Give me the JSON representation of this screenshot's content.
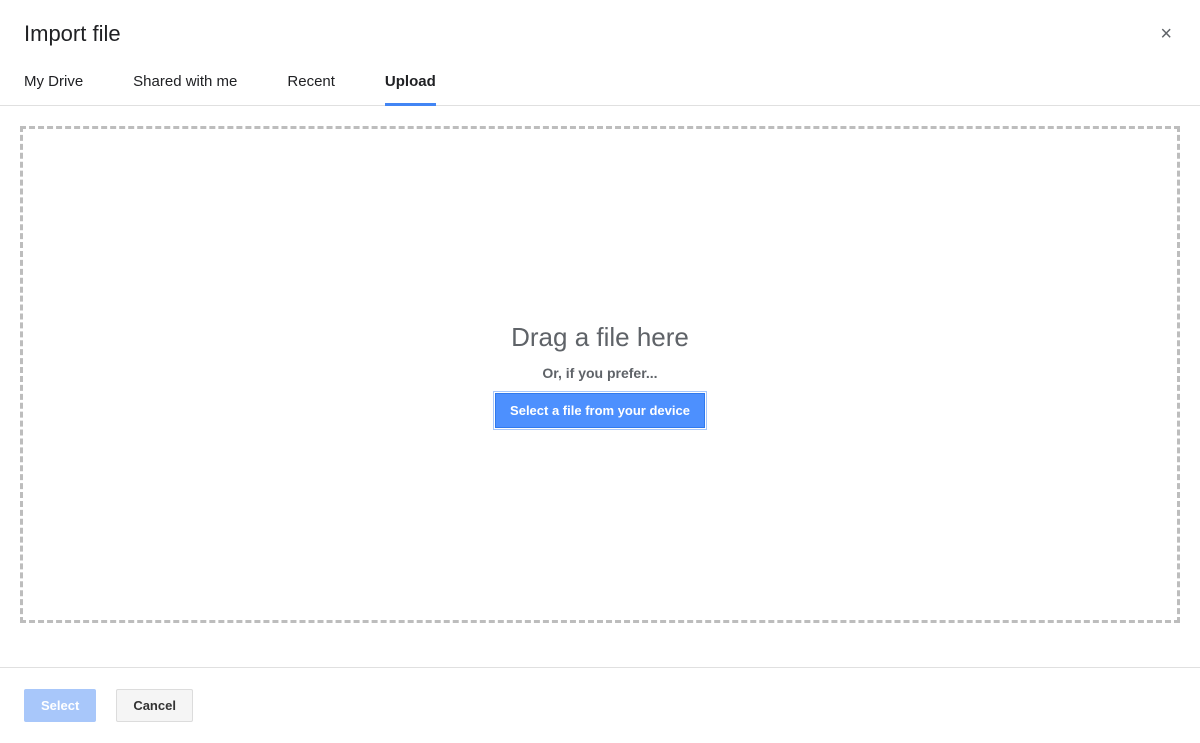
{
  "dialog": {
    "title": "Import file",
    "close_label": "×"
  },
  "tabs": {
    "items": [
      {
        "label": "My Drive"
      },
      {
        "label": "Shared with me"
      },
      {
        "label": "Recent"
      },
      {
        "label": "Upload"
      }
    ],
    "active_index": 3
  },
  "upload": {
    "drag_title": "Drag a file here",
    "or_text": "Or, if you prefer...",
    "select_device_label": "Select a file from your device"
  },
  "footer": {
    "select_label": "Select",
    "cancel_label": "Cancel"
  }
}
